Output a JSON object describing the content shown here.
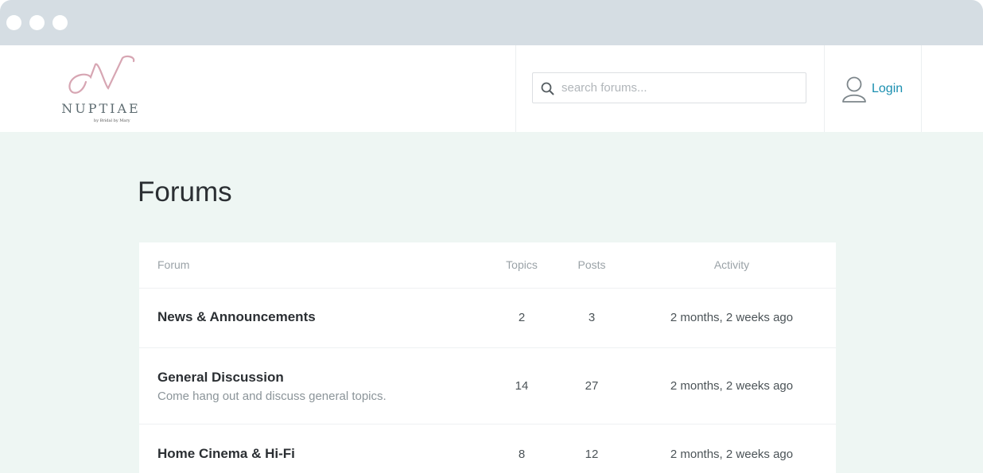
{
  "browser": {
    "controls": [
      "close",
      "minimize",
      "maximize"
    ]
  },
  "header": {
    "logo": {
      "wordmark": "NUPTIAE",
      "tagline": "by Bridal by Mary"
    },
    "search": {
      "placeholder": "search forums..."
    },
    "login": {
      "label": "Login"
    }
  },
  "main": {
    "title": "Forums",
    "table": {
      "columns": {
        "forum": "Forum",
        "topics": "Topics",
        "posts": "Posts",
        "activity": "Activity"
      },
      "rows": [
        {
          "name": "News & Announcements",
          "description": "",
          "topics": "2",
          "posts": "3",
          "activity": "2 months, 2 weeks ago"
        },
        {
          "name": "General Discussion",
          "description": "Come hang out and discuss general topics.",
          "topics": "14",
          "posts": "27",
          "activity": "2 months, 2 weeks ago"
        },
        {
          "name": "Home Cinema & Hi-Fi",
          "description": "",
          "topics": "8",
          "posts": "12",
          "activity": "2 months, 2 weeks ago"
        }
      ]
    }
  },
  "colors": {
    "accent": "#1a8fb0",
    "logo_pink": "#d7a6b3",
    "background": "#eef6f3",
    "chrome": "#d5dde3"
  }
}
